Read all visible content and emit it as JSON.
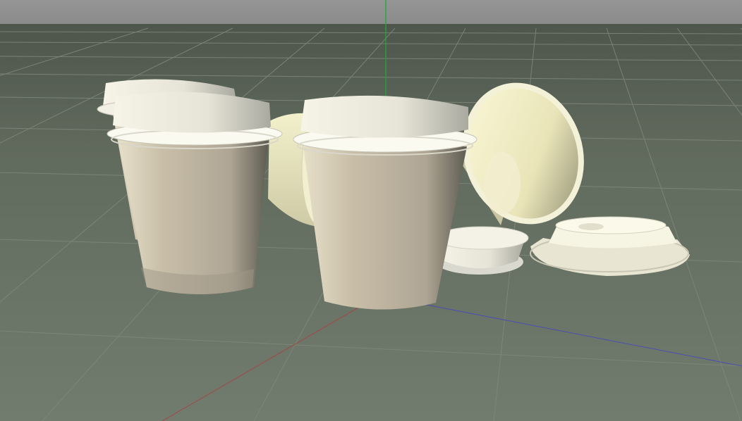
{
  "viewport": {
    "scene": "3d-viewport",
    "objects": [
      {
        "name": "cup-lidded-back-left"
      },
      {
        "name": "cup-lidded-front-left"
      },
      {
        "name": "cup-lidded-front-center"
      },
      {
        "name": "cup-tipped-back"
      },
      {
        "name": "cup-tipped-right"
      },
      {
        "name": "lid-loose-center"
      },
      {
        "name": "lid-loose-right"
      }
    ],
    "axes": {
      "y_axis_color": "#1fa83a",
      "x_axis_color": "#a04848",
      "z_axis_color": "#4a4fb0"
    },
    "colors": {
      "sky": "#8e8e8e",
      "floor": "#6b7568",
      "grid": "#7f897b",
      "cup_body": "#c9bfa8",
      "lid": "#f2f0e2"
    }
  }
}
